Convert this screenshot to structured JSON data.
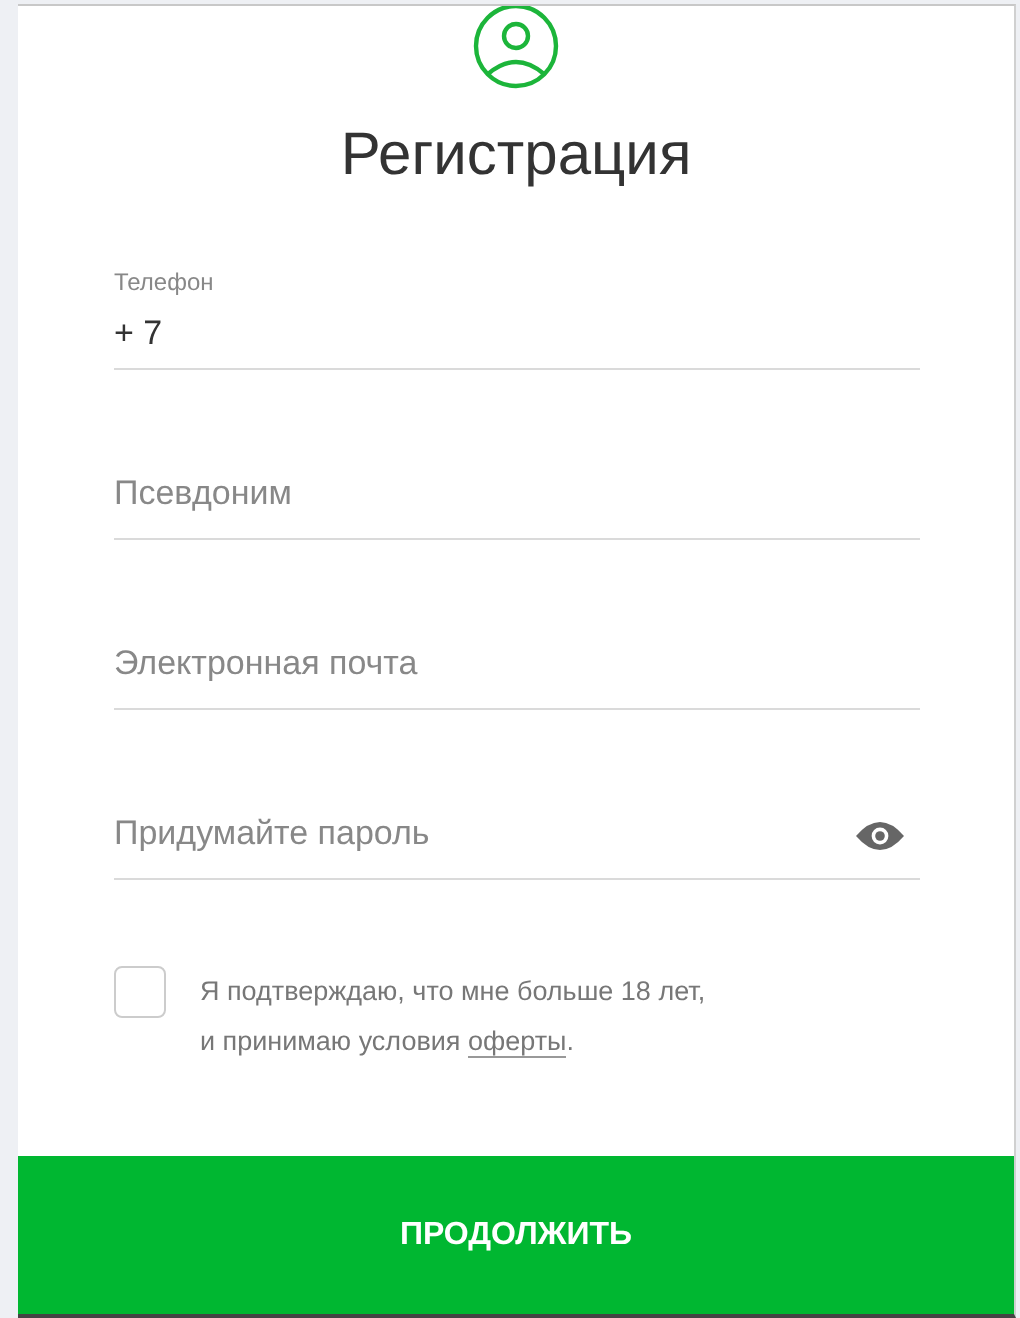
{
  "title": "Регистрация",
  "fields": [
    {
      "kind": "phone",
      "label": "Телефон",
      "value": "+ 7"
    },
    {
      "kind": "text",
      "placeholder": "Псевдоним"
    },
    {
      "kind": "email",
      "placeholder": "Электронная почта"
    },
    {
      "kind": "password",
      "placeholder": "Придумайте пароль"
    }
  ],
  "agreement": {
    "checked": false,
    "lines": [
      "Я подтверждаю, что мне больше 18 лет,",
      "и принимаю условия"
    ],
    "link": "оферты",
    "after": "."
  },
  "submit": "ПРОДОЛЖИТЬ"
}
